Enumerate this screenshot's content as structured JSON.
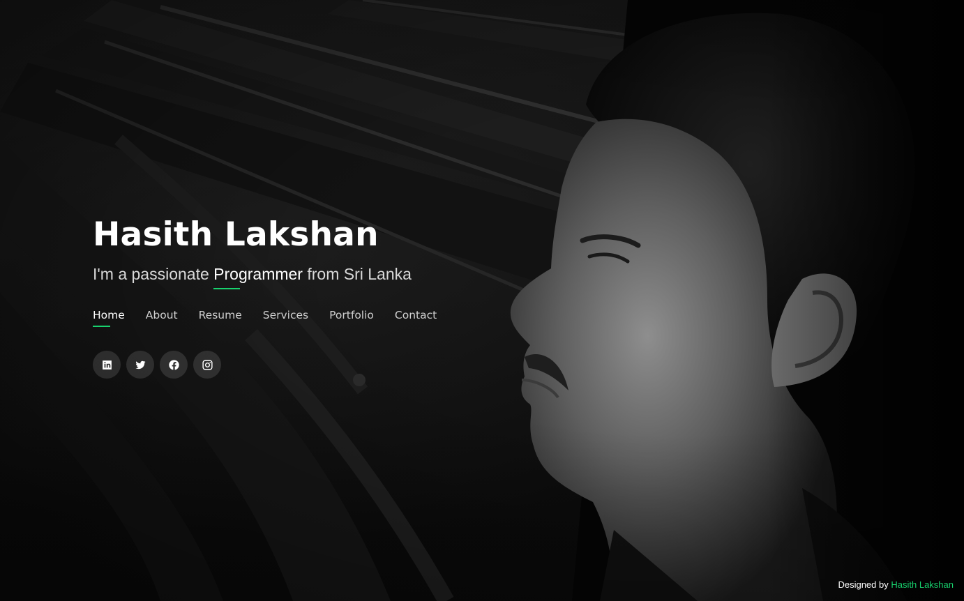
{
  "hero": {
    "name": "Hasith Lakshan",
    "tagline_prefix": "I'm a passionate ",
    "tagline_typed": "Programmer",
    "tagline_suffix": " from Sri Lanka"
  },
  "nav": {
    "items": [
      {
        "label": "Home",
        "active": true
      },
      {
        "label": "About",
        "active": false
      },
      {
        "label": "Resume",
        "active": false
      },
      {
        "label": "Services",
        "active": false
      },
      {
        "label": "Portfolio",
        "active": false
      },
      {
        "label": "Contact",
        "active": false
      }
    ]
  },
  "social": {
    "icons": [
      "linkedin-icon",
      "twitter-icon",
      "facebook-icon",
      "instagram-icon"
    ]
  },
  "footer": {
    "designed_by_label": "Designed by",
    "designer_name": "Hasith Lakshan"
  },
  "colors": {
    "accent": "#18d26e",
    "background": "#0b0b0b",
    "text_primary": "#ffffff",
    "text_muted": "#cfcfcf"
  }
}
